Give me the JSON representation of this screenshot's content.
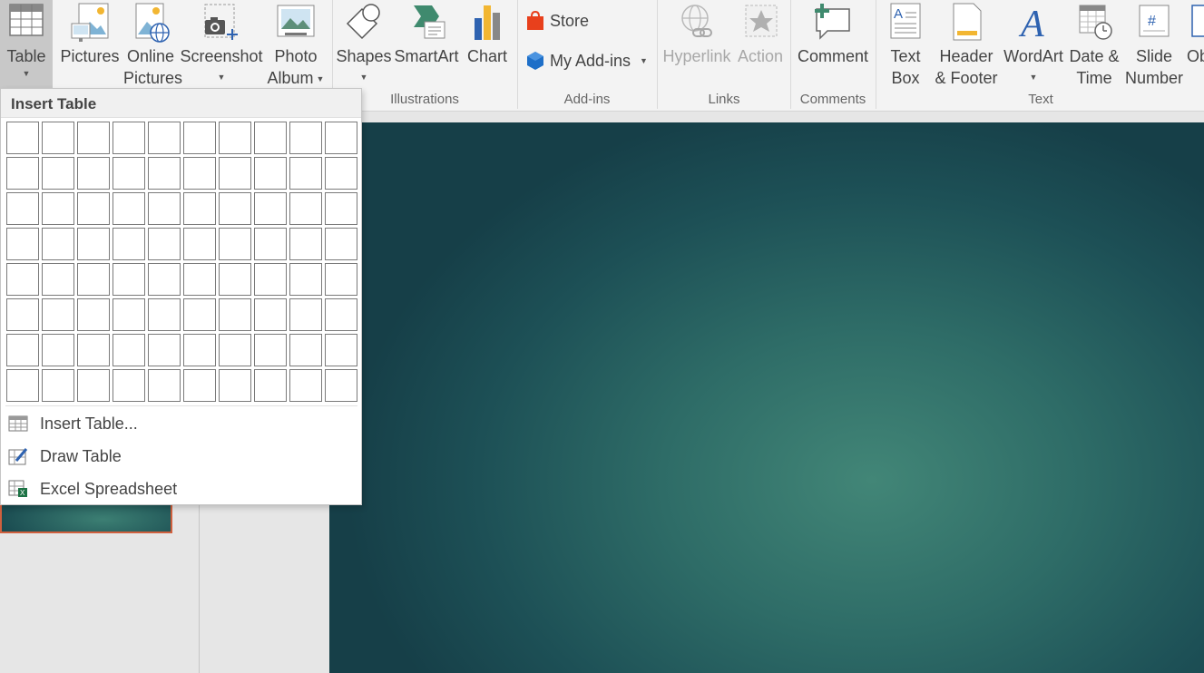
{
  "ribbon": {
    "table": {
      "label": "Table"
    },
    "pictures": {
      "label": "Pictures"
    },
    "online_pictures": {
      "line1": "Online",
      "line2": "Pictures"
    },
    "screenshot": {
      "label": "Screenshot"
    },
    "photo_album": {
      "line1": "Photo",
      "line2": "Album"
    },
    "shapes": {
      "label": "Shapes"
    },
    "smartart": {
      "label": "SmartArt"
    },
    "chart": {
      "label": "Chart"
    },
    "store": {
      "label": "Store"
    },
    "my_addins": {
      "label": "My Add-ins"
    },
    "hyperlink": {
      "label": "Hyperlink"
    },
    "action": {
      "label": "Action"
    },
    "comment": {
      "label": "Comment"
    },
    "text_box": {
      "line1": "Text",
      "line2": "Box"
    },
    "header_footer": {
      "line1": "Header",
      "line2": "& Footer"
    },
    "wordart": {
      "label": "WordArt"
    },
    "date_time": {
      "line1": "Date &",
      "line2": "Time"
    },
    "slide_number": {
      "line1": "Slide",
      "line2": "Number"
    },
    "object": {
      "label": "Ob"
    },
    "groups": {
      "illustrations": "Illustrations",
      "addins": "Add-ins",
      "links": "Links",
      "comments": "Comments",
      "text": "Text"
    }
  },
  "insert_table_menu": {
    "header": "Insert Table",
    "grid": {
      "rows": 8,
      "cols": 10
    },
    "items": [
      {
        "label": "Insert Table...",
        "icon": "table-grid-icon"
      },
      {
        "label": "Draw Table",
        "icon": "pencil-table-icon"
      },
      {
        "label": "Excel Spreadsheet",
        "icon": "excel-table-icon"
      }
    ]
  },
  "colors": {
    "ribbon_bg": "#f3f3f3",
    "selected_button": "#c8c8c8",
    "slide_center": "#428677",
    "slide_edge": "#163f48",
    "thumbnail_border": "#d0603e",
    "store_icon": "#e8401c",
    "addins_icon": "#1e6fc8",
    "wordart_blue": "#2e62b0"
  }
}
